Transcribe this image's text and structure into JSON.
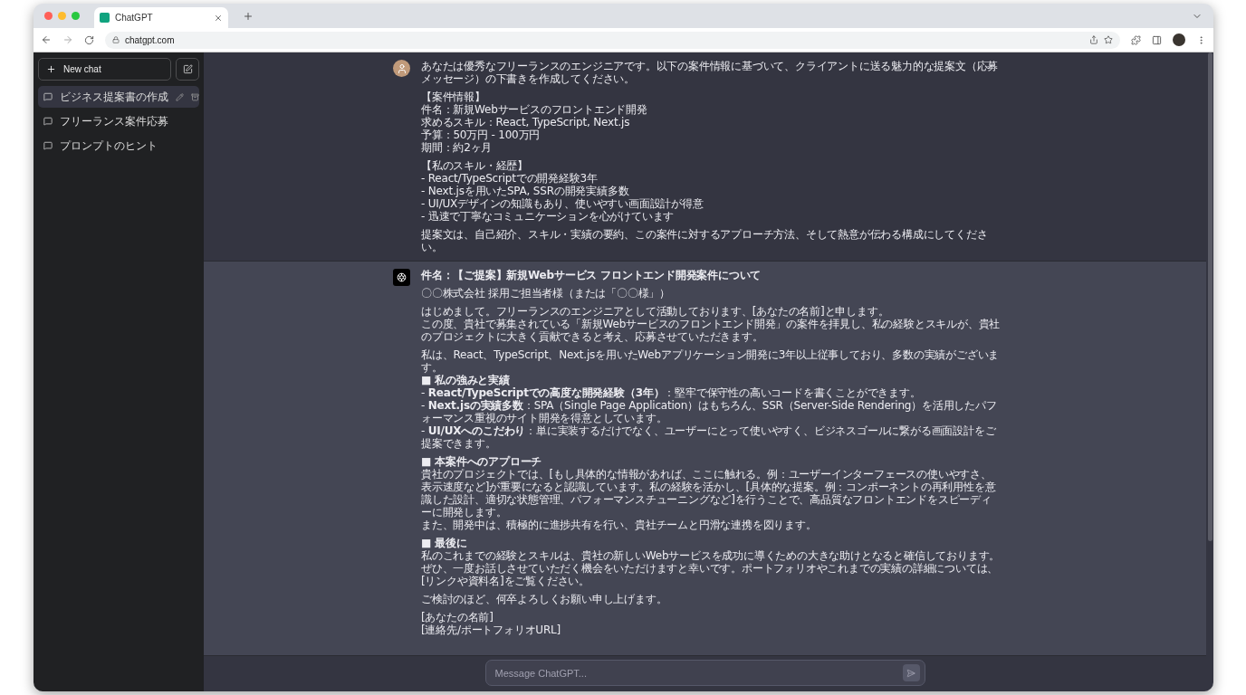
{
  "browser": {
    "tab_title": "ChatGPT",
    "url": "chatgpt.com"
  },
  "sidebar": {
    "new_chat": "New chat",
    "items": [
      {
        "label": "ビジネス提案書の作成",
        "selected": true
      },
      {
        "label": "フリーランス案件応募",
        "selected": false
      },
      {
        "label": "プロンプトのヒント",
        "selected": false
      }
    ]
  },
  "messages": [
    {
      "kind": "user",
      "blocks": [
        {
          "kind": "text",
          "lines": [
            "あなたは優秀なフリーランスのエンジニアです。以下の案件情報に基づいて、クライアントに送る魅力的な提案文（応募メッセージ）の下書きを作成してください。"
          ]
        },
        {
          "kind": "text",
          "lines": [
            "【案件情報】",
            "件名：新規Webサービスのフロントエンド開発",
            "求めるスキル：React, TypeScript, Next.js",
            "予算：50万円 - 100万円",
            "期間：約2ヶ月"
          ]
        },
        {
          "kind": "text",
          "lines": [
            "【私のスキル・経歴】",
            "- React/TypeScriptでの開発経験3年",
            "- Next.jsを用いたSPA, SSRの開発実績多数",
            "- UI/UXデザインの知識もあり、使いやすい画面設計が得意",
            "- 迅速で丁寧なコミュニケーションを心がけています"
          ]
        },
        {
          "kind": "text",
          "lines": [
            "提案文は、自己紹介、スキル・実績の要約、この案件に対するアプローチ方法、そして熱意が伝わる構成にしてください。"
          ]
        }
      ]
    },
    {
      "kind": "assistant",
      "blocks": [
        {
          "kind": "subject",
          "lines": [
            "件名：【ご提案】新規Webサービス フロントエンド開発案件について"
          ]
        },
        {
          "kind": "text",
          "lines": [
            "〇〇株式会社 採用ご担当者様（または「〇〇様」）"
          ]
        },
        {
          "kind": "text",
          "lines": [
            "はじめまして。フリーランスのエンジニアとして活動しております、[あなたの名前]と申します。",
            "この度、貴社で募集されている「新規Webサービスのフロントエンド開発」の案件を拝見し、私の経験とスキルが、貴社のプロジェクトに大きく貢献できると考え、応募させていただきます。"
          ]
        },
        {
          "kind": "text",
          "lines": [
            "私は、React、TypeScript、Next.jsを用いたWebアプリケーション開発に3年以上従事しており、多数の実績がございます。",
            "**■ 私の強みと実績**",
            "- **React/TypeScriptでの高度な開発経験（3年）**：堅牢で保守性の高いコードを書くことができます。",
            "- **Next.jsの実績多数**：SPA（Single Page Application）はもちろん、SSR（Server-Side Rendering）を活用したパフォーマンス重視のサイト開発を得意としています。",
            "- **UI/UXへのこだわり**：単に実装するだけでなく、ユーザーにとって使いやすく、ビジネスゴールに繋がる画面設計をご提案できます。"
          ]
        },
        {
          "kind": "text",
          "lines": [
            "**■ 本案件へのアプローチ**",
            "貴社のプロジェクトでは、[もし具体的な情報があれば、ここに触れる。例：ユーザーインターフェースの使いやすさ、表示速度など]が重要になると認識しています。私の経験を活かし、[具体的な提案。例：コンポーネントの再利用性を意識した設計、適切な状態管理、パフォーマンスチューニングなど]を行うことで、高品質なフロントエンドをスピーディーに開発します。",
            "また、開発中は、積極的に進捗共有を行い、貴社チームと円滑な連携を図ります。"
          ]
        },
        {
          "kind": "text",
          "lines": [
            "**■ 最後に**",
            "私のこれまでの経験とスキルは、貴社の新しいWebサービスを成功に導くための大きな助けとなると確信しております。ぜひ、一度お話しさせていただく機会をいただけますと幸いです。ポートフォリオやこれまでの実績の詳細については、[リンクや資料名]をご覧ください。"
          ]
        },
        {
          "kind": "text",
          "lines": [
            "ご検討のほど、何卒よろしくお願い申し上げます。"
          ]
        },
        {
          "kind": "text",
          "lines": [
            "[あなたの名前]",
            "[連絡先/ポートフォリオURL]"
          ]
        }
      ]
    }
  ],
  "composer": {
    "placeholder": "Message ChatGPT..."
  }
}
